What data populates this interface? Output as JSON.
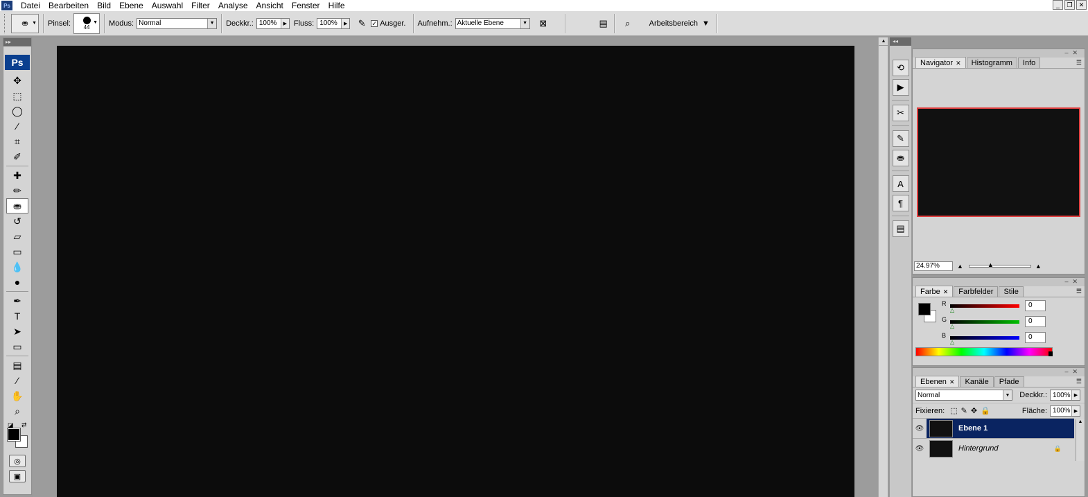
{
  "app": {
    "logo_text": "Ps"
  },
  "menu": [
    "Datei",
    "Bearbeiten",
    "Bild",
    "Ebene",
    "Auswahl",
    "Filter",
    "Analyse",
    "Ansicht",
    "Fenster",
    "Hilfe"
  ],
  "window_controls": {
    "minimize": "_",
    "restore": "❐",
    "close": "✕"
  },
  "options_bar": {
    "brush_label": "Pinsel:",
    "brush_size": "44",
    "mode_label": "Modus:",
    "mode_value": "Normal",
    "opacity_label": "Deckkr.:",
    "opacity_value": "100%",
    "flow_label": "Fluss:",
    "flow_value": "100%",
    "aligned_label": "Ausger.",
    "aligned_checked": "✓",
    "sample_label": "Aufnehm.:",
    "sample_value": "Aktuelle Ebene",
    "workspace_label": "Arbeitsbereich"
  },
  "toolbox": {
    "badge": "Ps"
  },
  "navigator": {
    "tabs": [
      "Navigator",
      "Histogramm",
      "Info"
    ],
    "zoom_value": "24.97%"
  },
  "color_panel": {
    "tabs": [
      "Farbe",
      "Farbfelder",
      "Stile"
    ],
    "channels": [
      {
        "label": "R",
        "value": "0",
        "color": "#ff0000"
      },
      {
        "label": "G",
        "value": "0",
        "color": "#00c000"
      },
      {
        "label": "B",
        "value": "0",
        "color": "#0000ff"
      }
    ]
  },
  "layers_panel": {
    "tabs": [
      "Ebenen",
      "Kanäle",
      "Pfade"
    ],
    "blend_mode": "Normal",
    "opacity_label": "Deckkr.:",
    "opacity_value": "100%",
    "lock_label": "Fixieren:",
    "fill_label": "Fläche:",
    "fill_value": "100%",
    "layers": [
      {
        "name": "Ebene 1"
      },
      {
        "name": "Hintergrund"
      }
    ]
  },
  "colors": {
    "accent_selected": "#0a2461",
    "canvas": "#0c0c0c",
    "navigator_frame": "#e04040"
  }
}
